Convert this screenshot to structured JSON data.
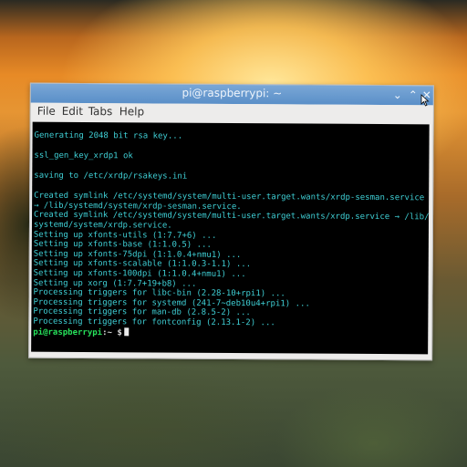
{
  "window": {
    "title": "pi@raspberrypi: ~",
    "buttons": {
      "minimize": "⌄",
      "maximize": "⌃",
      "close": "✕"
    }
  },
  "menu": [
    "File",
    "Edit",
    "Tabs",
    "Help"
  ],
  "terminal": {
    "lines": [
      "Generating 2048 bit rsa key...",
      "",
      "ssl_gen_key_xrdp1 ok",
      "",
      "saving to /etc/xrdp/rsakeys.ini",
      "",
      "Created symlink /etc/systemd/system/multi-user.target.wants/xrdp-sesman.service",
      "→ /lib/systemd/system/xrdp-sesman.service.",
      "Created symlink /etc/systemd/system/multi-user.target.wants/xrdp.service → /lib/",
      "systemd/system/xrdp.service.",
      "Setting up xfonts-utils (1:7.7+6) ...",
      "Setting up xfonts-base (1:1.0.5) ...",
      "Setting up xfonts-75dpi (1:1.0.4+nmu1) ...",
      "Setting up xfonts-scalable (1:1.0.3-1.1) ...",
      "Setting up xfonts-100dpi (1:1.0.4+nmu1) ...",
      "Setting up xorg (1:7.7+19+b8) ...",
      "Processing triggers for libc-bin (2.28-10+rpi1) ...",
      "Processing triggers for systemd (241-7~deb10u4+rpi1) ...",
      "Processing triggers for man-db (2.8.5-2) ...",
      "Processing triggers for fontconfig (2.13.1-2) ..."
    ],
    "prompt_user": "pi@raspberrypi",
    "prompt_suffix": ":~ $"
  },
  "colors": {
    "output_text": "#3fd0d6",
    "prompt_user": "#27e25b",
    "titlebar": "#5a8fc8",
    "terminal_bg": "#000000"
  }
}
